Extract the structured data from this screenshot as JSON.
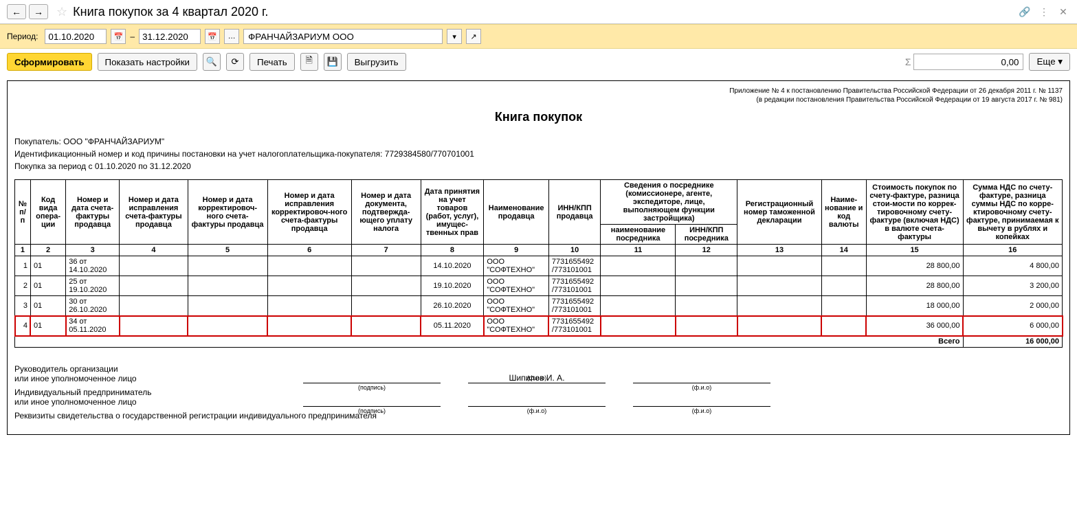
{
  "header": {
    "title": "Книга покупок за 4 квартал 2020 г."
  },
  "period": {
    "label": "Период:",
    "from": "01.10.2020",
    "dash": "–",
    "to": "31.12.2020",
    "org": "ФРАНЧАЙЗАРИУМ ООО"
  },
  "toolbar": {
    "form": "Сформировать",
    "show_settings": "Показать настройки",
    "print": "Печать",
    "export": "Выгрузить",
    "more": "Еще ▾",
    "sum": "0,00"
  },
  "report": {
    "legal1": "Приложение № 4 к постановлению Правительства Российской Федерации от 26 декабря 2011 г. № 1137",
    "legal2": "(в редакции постановления Правительства Российской Федерации от 19 августа 2017 г. № 981)",
    "title": "Книга покупок",
    "buyer": "Покупатель:  ООО \"ФРАНЧАЙЗАРИУМ\"",
    "inn": "Идентификационный номер и код причины постановки на учет налогоплательщика-покупателя:  7729384580/770701001",
    "period_line": "Покупка за период с 01.10.2020 по 31.12.2020"
  },
  "columns": {
    "c1": "№ п/п",
    "c2": "Код вида опера-ции",
    "c3": "Номер и дата счета-фактуры продавца",
    "c4": "Номер и дата исправления счета-фактуры продавца",
    "c5": "Номер и дата корректировоч-ного счета-фактуры продавца",
    "c6": "Номер и дата исправления корректировоч-ного счета-фактуры продавца",
    "c7": "Номер и дата документа, подтвержда-ющего уплату налога",
    "c8": "Дата принятия на учет товаров (работ, услуг), имущес-твенных прав",
    "c9": "Наименование продавца",
    "c10": "ИНН/КПП продавца",
    "c11_12": "Сведения о посреднике (комиссионере, агенте, экспедиторе, лице, выполняющем функции застройщика)",
    "c11": "наименование посредника",
    "c12": "ИНН/КПП посредника",
    "c13": "Регистрационный номер таможенной декларации",
    "c14": "Наиме-нование и код валюты",
    "c15": "Стоимость покупок по счету-фактуре, разница стои-мости по коррек-тировочному счету-фактуре (включая НДС) в валюте счета-фактуры",
    "c16": "Сумма НДС по счету-фактуре, разница суммы НДС по корре-ктировочному счету-фактуре, принимаемая к вычету в рублях и копейках"
  },
  "colnums": [
    "1",
    "2",
    "3",
    "4",
    "5",
    "6",
    "7",
    "8",
    "9",
    "10",
    "11",
    "12",
    "13",
    "14",
    "15",
    "16"
  ],
  "rows": [
    {
      "n": "1",
      "code": "01",
      "sf": "36 от 14.10.2020",
      "date": "14.10.2020",
      "seller": "ООО \"СОФТЕХНО\"",
      "inn": "7731655492 /773101001",
      "cost": "28 800,00",
      "vat": "4 800,00",
      "hl": false
    },
    {
      "n": "2",
      "code": "01",
      "sf": "25 от 19.10.2020",
      "date": "19.10.2020",
      "seller": "ООО \"СОФТЕХНО\"",
      "inn": "7731655492 /773101001",
      "cost": "28 800,00",
      "vat": "3 200,00",
      "hl": false
    },
    {
      "n": "3",
      "code": "01",
      "sf": "30 от 26.10.2020",
      "date": "26.10.2020",
      "seller": "ООО \"СОФТЕХНО\"",
      "inn": "7731655492 /773101001",
      "cost": "18 000,00",
      "vat": "2 000,00",
      "hl": false
    },
    {
      "n": "4",
      "code": "01",
      "sf": "34 от 05.11.2020",
      "date": "05.11.2020",
      "seller": "ООО \"СОФТЕХНО\"",
      "inn": "7731655492 /773101001",
      "cost": "36 000,00",
      "vat": "6 000,00",
      "hl": true
    }
  ],
  "total": {
    "label": "Всего",
    "value": "16 000,00"
  },
  "sig": {
    "head1": "Руководитель организации",
    "head2": "или иное уполномоченное лицо",
    "ip1": "Индивидуальный предприниматель",
    "ip2": "или иное уполномоченное лицо",
    "name": "Шипилов И. А.",
    "cap_sign": "(подпись)",
    "cap_fio": "(ф.и.о)",
    "rekviz": "Реквизиты свидетельства о государственной регистрации индивидуального предпринимателя"
  }
}
